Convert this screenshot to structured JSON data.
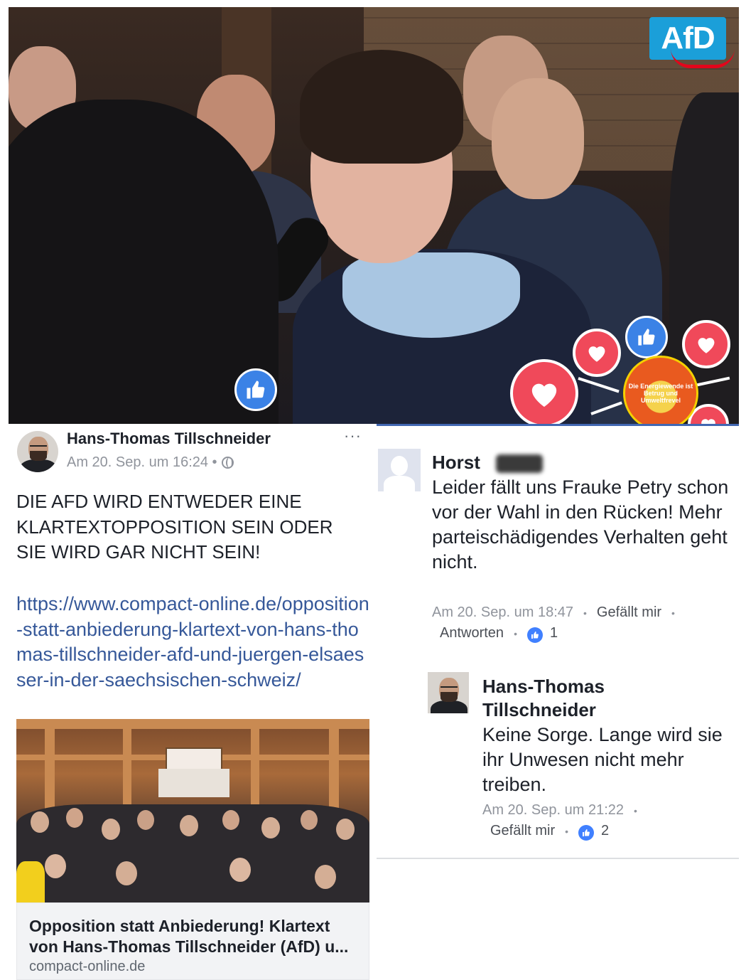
{
  "video": {
    "logo_text": "AfD",
    "badge_text": "Die Energiewende ist Betrug und Umweltfrevel"
  },
  "post": {
    "author": "Hans-Thomas Tillschneider",
    "timestamp": "Am 20. Sep. um 16:24 •",
    "more": "···",
    "text": "DIE AFD WIRD ENTWEDER EINE KLARTEXTOPPOSITION SEIN ODER SIE WIRD GAR NICHT SEIN!",
    "link": "https://www.compact-online.de/opposition-statt-anbiederung-klartext-von-hans-thomas-tillschneider-afd-und-juergen-elsaesser-in-der-saechsischen-schweiz/",
    "preview": {
      "title": "Opposition statt Anbiederung! Klartext von Hans-Thomas Tillschneider (AfD) u...",
      "domain": "compact-online.de"
    }
  },
  "comments": [
    {
      "author": "Horst",
      "text": "Leider fällt uns Frauke Petry schon vor der Wahl in den Rücken! Mehr parteischädigendes Verhalten geht nicht.",
      "time": "Am 20. Sep. um 18:47",
      "like_label": "Gefällt mir",
      "reply_label": "Antworten",
      "likes": "1"
    },
    {
      "author": "Hans-Thomas Tillschneider",
      "text": "Keine Sorge. Lange wird sie ihr Unwesen nicht mehr treiben.",
      "time": "Am 20. Sep. um 21:22",
      "like_label": "Gefällt mir",
      "likes": "2"
    }
  ],
  "colors": {
    "link": "#365899",
    "like_blue": "#4080ff",
    "heart_red": "#f0495a",
    "afd_blue": "#1b9fd9"
  },
  "icons": [
    "like-icon",
    "heart-icon",
    "globe-icon",
    "more-icon"
  ]
}
